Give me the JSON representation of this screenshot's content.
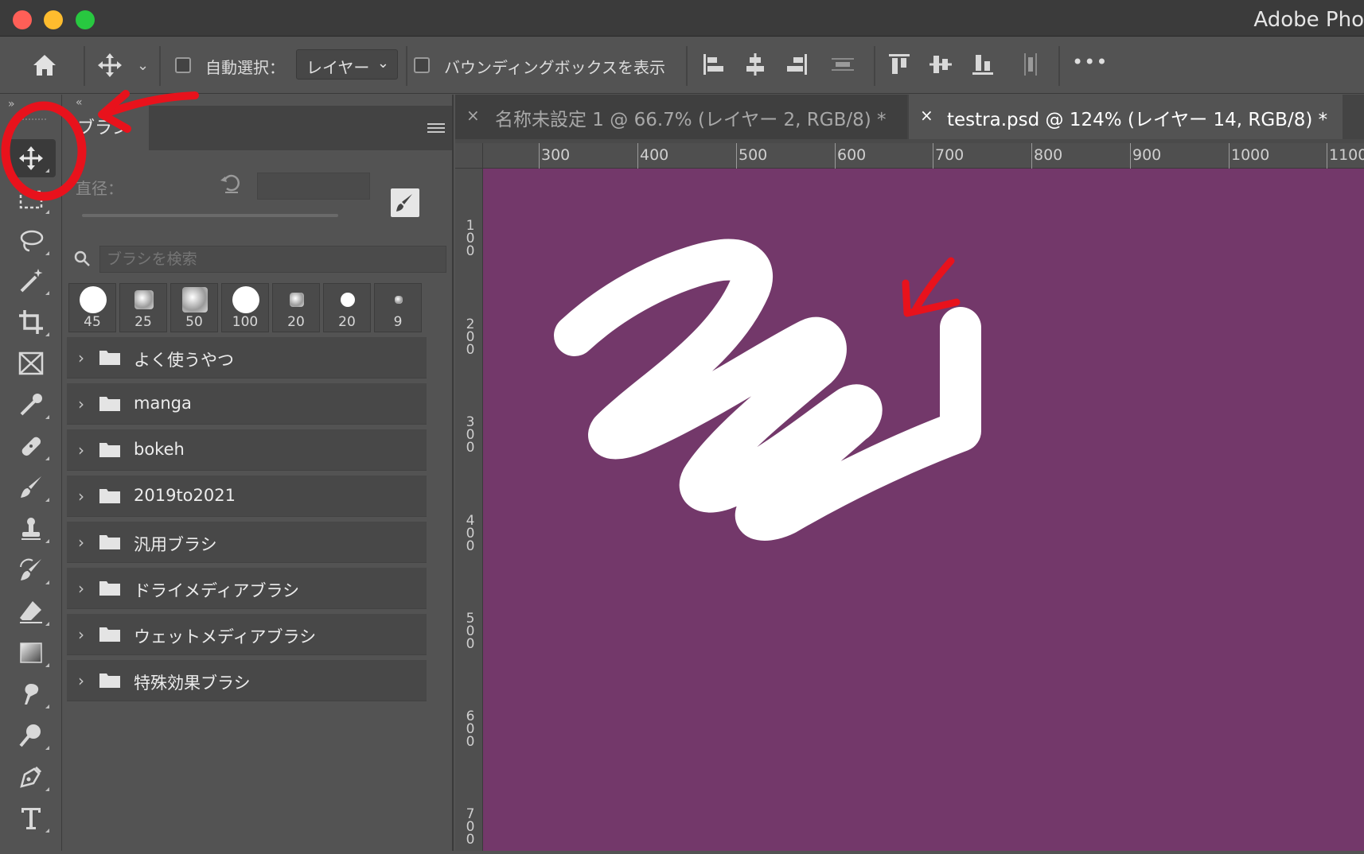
{
  "window": {
    "app_title": "Adobe Pho",
    "colors": {
      "close": "#fe5f57",
      "minimize": "#febc2e",
      "maximize": "#28c840"
    }
  },
  "options_bar": {
    "auto_select_label": "自動選択：",
    "auto_select_dropdown": "レイヤー",
    "bounding_box_label": "バウンディングボックスを表示",
    "more_label": "•••"
  },
  "brush_panel": {
    "tab_label": "ブラシ",
    "size_label": "直径：",
    "search_placeholder": "ブラシを検索",
    "presets": [
      {
        "size": "45",
        "kind": "hard-round"
      },
      {
        "size": "25",
        "kind": "texture"
      },
      {
        "size": "50",
        "kind": "texture"
      },
      {
        "size": "100",
        "kind": "hard-round"
      },
      {
        "size": "20",
        "kind": "texture"
      },
      {
        "size": "20",
        "kind": "hard-round"
      },
      {
        "size": "9",
        "kind": "texture"
      }
    ],
    "folders": [
      {
        "label": "よく使うやつ"
      },
      {
        "label": "manga"
      },
      {
        "label": "bokeh"
      },
      {
        "label": "2019to2021"
      },
      {
        "label": "汎用ブラシ"
      },
      {
        "label": "ドライメディアブラシ"
      },
      {
        "label": "ウェットメディアブラシ"
      },
      {
        "label": "特殊効果ブラシ"
      }
    ]
  },
  "document_tabs": [
    {
      "title": "名称未設定 1 @ 66.7% (レイヤー 2, RGB/8) *",
      "active": false
    },
    {
      "title": "testra.psd @ 124% (レイヤー 14, RGB/8) *",
      "active": true
    }
  ],
  "rulers": {
    "horizontal": [
      "300",
      "400",
      "500",
      "600",
      "700",
      "800",
      "900",
      "1000",
      "1100"
    ],
    "vertical": [
      "100",
      "200",
      "300",
      "400",
      "500",
      "600",
      "700"
    ]
  },
  "canvas": {
    "background": "#73386a",
    "stroke_color": "#ffffff"
  },
  "annotations": {
    "color": "#e8121c"
  }
}
